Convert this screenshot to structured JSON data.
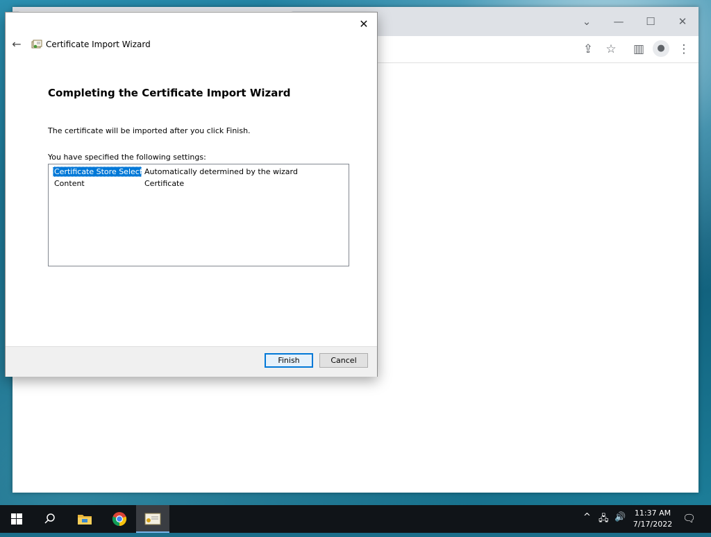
{
  "dialog": {
    "title": "Certificate Import Wizard",
    "heading": "Completing the Certificate Import Wizard",
    "info": "The certificate will be imported after you click Finish.",
    "settings_label": "You have specified the following settings:",
    "settings": [
      {
        "name": "Certificate Store Selected",
        "value": "Automatically determined by the wizard"
      },
      {
        "name": "Content",
        "value": "Certificate"
      }
    ],
    "finish_label": "Finish",
    "cancel_label": "Cancel",
    "close_glyph": "✕",
    "back_glyph": "←"
  },
  "browser": {
    "icons": [
      "chevron-down-icon",
      "minimize-icon",
      "maximize-icon",
      "close-icon",
      "share-icon",
      "star-icon",
      "side-panel-icon",
      "profile-icon",
      "menu-icon"
    ]
  },
  "taskbar": {
    "time": "11:37 AM",
    "date": "7/17/2022",
    "icons": [
      "windows-start-icon",
      "search-icon",
      "file-explorer-icon",
      "chrome-icon",
      "certificate-icon"
    ]
  },
  "colors": {
    "selection": "#0078d7",
    "taskbar": "#101418",
    "accent": "#0078d7"
  }
}
